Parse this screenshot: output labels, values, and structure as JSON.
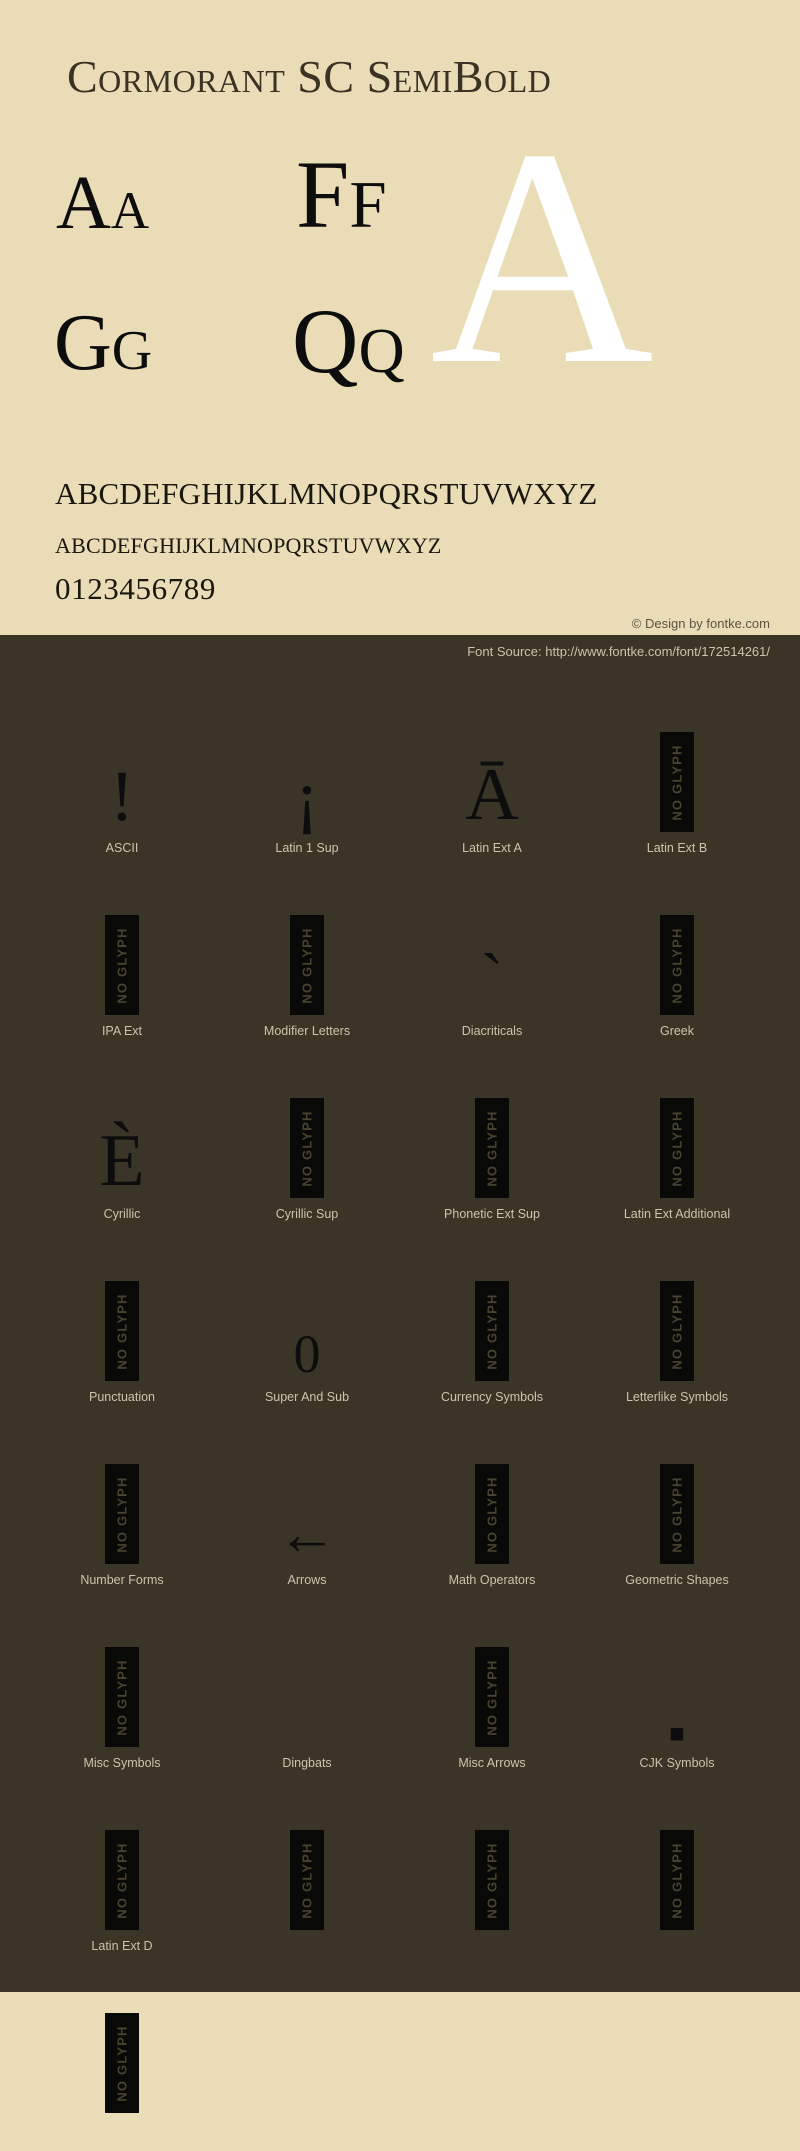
{
  "header": {
    "title": "Cormorant SC SemiBold"
  },
  "showcase": {
    "pairs": [
      {
        "name": "aa",
        "text": "Aa"
      },
      {
        "name": "ff",
        "text": "Ff"
      },
      {
        "name": "gg",
        "text": "Gg"
      },
      {
        "name": "qq",
        "text": "Qq"
      }
    ],
    "hero_letter": "A"
  },
  "alphabet": {
    "uppercase": "ABCDEFGHIJKLMNOPQRSTUVWXYZ",
    "smallcaps": "abcdefghijklmnopqrstuvwxyz",
    "numerals": "0123456789"
  },
  "credit": {
    "design": "© Design by fontke.com",
    "source": "Font Source: http://www.fontke.com/font/172514261/"
  },
  "colors": {
    "light_bg": "#e9dcb6",
    "dark_bg": "#3b3527",
    "ink": "#0d0d0d",
    "hero": "#ffffff",
    "label": "#cdc4ac",
    "noglyph_bg": "#090908",
    "noglyph_text": "#4a4331"
  },
  "noglyph_label": "NO GLYPH",
  "unicode_blocks": [
    [
      {
        "label": "ASCII",
        "sample": "!",
        "kind": "glyph",
        "style": "excl"
      },
      {
        "label": "Latin 1 Sup",
        "sample": "¡",
        "kind": "glyph",
        "style": "invexcl"
      },
      {
        "label": "Latin Ext A",
        "sample": "Ā",
        "kind": "glyph",
        "style": "amacron"
      },
      {
        "label": "Latin Ext B",
        "sample": "",
        "kind": "noglyph",
        "style": ""
      }
    ],
    [
      {
        "label": "IPA Ext",
        "sample": "",
        "kind": "noglyph",
        "style": ""
      },
      {
        "label": "Modifier Letters",
        "sample": "",
        "kind": "noglyph",
        "style": ""
      },
      {
        "label": "Diacriticals",
        "sample": "ˋ",
        "kind": "glyph",
        "style": "breve"
      },
      {
        "label": "Greek",
        "sample": "",
        "kind": "noglyph",
        "style": ""
      }
    ],
    [
      {
        "label": "Cyrillic",
        "sample": "È",
        "kind": "glyph",
        "style": "egrave"
      },
      {
        "label": "Cyrillic Sup",
        "sample": "",
        "kind": "noglyph",
        "style": ""
      },
      {
        "label": "Phonetic Ext Sup",
        "sample": "",
        "kind": "noglyph",
        "style": ""
      },
      {
        "label": "Latin Ext Additional",
        "sample": "",
        "kind": "noglyph",
        "style": ""
      }
    ],
    [
      {
        "label": "Punctuation",
        "sample": "",
        "kind": "noglyph",
        "style": ""
      },
      {
        "label": "Super And Sub",
        "sample": "0",
        "kind": "glyph",
        "style": "zero"
      },
      {
        "label": "Currency Symbols",
        "sample": "",
        "kind": "noglyph",
        "style": ""
      },
      {
        "label": "Letterlike Symbols",
        "sample": "",
        "kind": "noglyph",
        "style": ""
      }
    ],
    [
      {
        "label": "Number Forms",
        "sample": "",
        "kind": "noglyph",
        "style": ""
      },
      {
        "label": "Arrows",
        "sample": "←",
        "kind": "glyph",
        "style": "arrow"
      },
      {
        "label": "Math Operators",
        "sample": "",
        "kind": "noglyph",
        "style": ""
      },
      {
        "label": "Geometric Shapes",
        "sample": "",
        "kind": "noglyph",
        "style": ""
      }
    ],
    [
      {
        "label": "Misc Symbols",
        "sample": "",
        "kind": "noglyph",
        "style": ""
      },
      {
        "label": "Dingbats",
        "sample": "",
        "kind": "blank",
        "style": ""
      },
      {
        "label": "Misc Arrows",
        "sample": "",
        "kind": "noglyph",
        "style": ""
      },
      {
        "label": "CJK Symbols",
        "sample": "■",
        "kind": "glyph",
        "style": "square"
      }
    ],
    [
      {
        "label": "Latin Ext D",
        "sample": "",
        "kind": "noglyph",
        "style": ""
      },
      {
        "label": "",
        "sample": "",
        "kind": "noglyph",
        "style": ""
      },
      {
        "label": "",
        "sample": "",
        "kind": "noglyph",
        "style": ""
      },
      {
        "label": "",
        "sample": "",
        "kind": "noglyph",
        "style": ""
      }
    ],
    [
      {
        "label": "",
        "sample": "",
        "kind": "noglyph",
        "style": ""
      },
      {
        "label": "",
        "sample": "",
        "kind": "blank",
        "style": ""
      },
      {
        "label": "",
        "sample": "",
        "kind": "blank",
        "style": ""
      },
      {
        "label": "",
        "sample": "",
        "kind": "blank",
        "style": ""
      }
    ]
  ]
}
